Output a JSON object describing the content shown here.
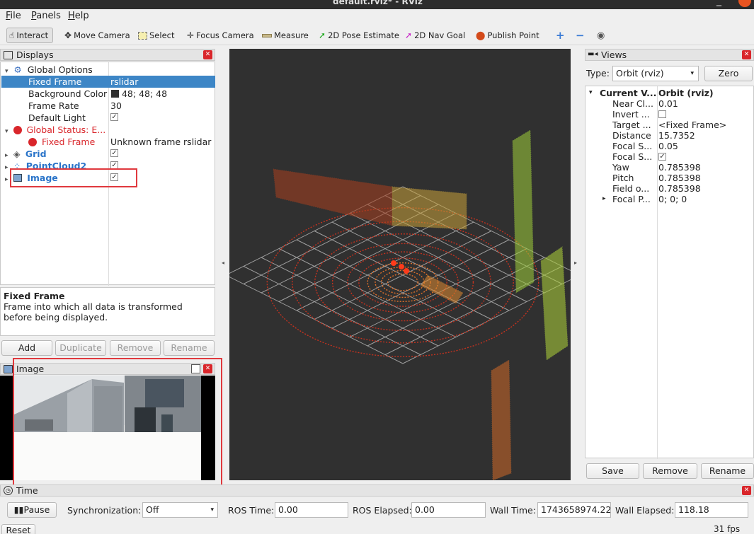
{
  "window": {
    "title": "default.rviz* - RViz"
  },
  "menu": [
    "File",
    "Panels",
    "Help"
  ],
  "toolbar": {
    "tools": [
      {
        "label": "Interact",
        "icon": "hand-icon"
      },
      {
        "label": "Move Camera",
        "icon": "move-camera-icon"
      },
      {
        "label": "Select",
        "icon": "select-icon"
      },
      {
        "label": "Focus Camera",
        "icon": "focus-camera-icon"
      },
      {
        "label": "Measure",
        "icon": "ruler-icon"
      },
      {
        "label": "2D Pose Estimate",
        "icon": "pose-arrow-icon"
      },
      {
        "label": "2D Nav Goal",
        "icon": "goal-arrow-icon"
      },
      {
        "label": "Publish Point",
        "icon": "map-pin-icon"
      }
    ],
    "extra_icons": [
      "plus-icon",
      "minus-icon",
      "eye-icon"
    ]
  },
  "displays": {
    "title": "Displays",
    "rows": [
      {
        "name": "Global Options",
        "value": ""
      },
      {
        "name": "Fixed Frame",
        "value": "rslidar"
      },
      {
        "name": "Background Color",
        "value": "48; 48; 48"
      },
      {
        "name": "Frame Rate",
        "value": "30"
      },
      {
        "name": "Default Light",
        "value": ""
      },
      {
        "name": "Global Status: E...",
        "value": ""
      },
      {
        "name": "Fixed Frame",
        "value": "Unknown frame rslidar"
      },
      {
        "name": "Grid",
        "value": ""
      },
      {
        "name": "PointCloud2",
        "value": ""
      },
      {
        "name": "Image",
        "value": ""
      }
    ],
    "help_title": "Fixed Frame",
    "help_text": "Frame into which all data is transformed before being displayed.",
    "buttons": [
      "Add",
      "Duplicate",
      "Remove",
      "Rename"
    ],
    "colors": {
      "selected": "#3d86c6",
      "error": "#d9262b",
      "link": "#2a74c9"
    }
  },
  "image_panel": {
    "title": "Image"
  },
  "views": {
    "title": "Views",
    "type_label": "Type:",
    "type_value": "Orbit (rviz)",
    "zero_label": "Zero",
    "rows": [
      {
        "name": "Current V...",
        "value": "Orbit (rviz)"
      },
      {
        "name": "Near Cl...",
        "value": "0.01"
      },
      {
        "name": "Invert ...",
        "value": ""
      },
      {
        "name": "Target ...",
        "value": "<Fixed Frame>"
      },
      {
        "name": "Distance",
        "value": "15.7352"
      },
      {
        "name": "Focal S...",
        "value": "0.05"
      },
      {
        "name": "Focal S...",
        "value": ""
      },
      {
        "name": "Yaw",
        "value": "0.785398"
      },
      {
        "name": "Pitch",
        "value": "0.785398"
      },
      {
        "name": "Field o...",
        "value": "0.785398"
      },
      {
        "name": "Focal P...",
        "value": "0; 0; 0"
      }
    ],
    "buttons": [
      "Save",
      "Remove",
      "Rename"
    ]
  },
  "time": {
    "title": "Time",
    "pause_label": "Pause",
    "sync_label": "Synchronization:",
    "sync_value": "Off",
    "ros_time_label": "ROS Time:",
    "ros_time": "0.00",
    "ros_elapsed_label": "ROS Elapsed:",
    "ros_elapsed": "0.00",
    "wall_time_label": "Wall Time:",
    "wall_time": "1743658974.22",
    "wall_elapsed_label": "Wall Elapsed:",
    "wall_elapsed": "118.18",
    "reset_label": "Reset",
    "fps": "31 fps"
  },
  "viewport": {
    "background": "#303030"
  }
}
